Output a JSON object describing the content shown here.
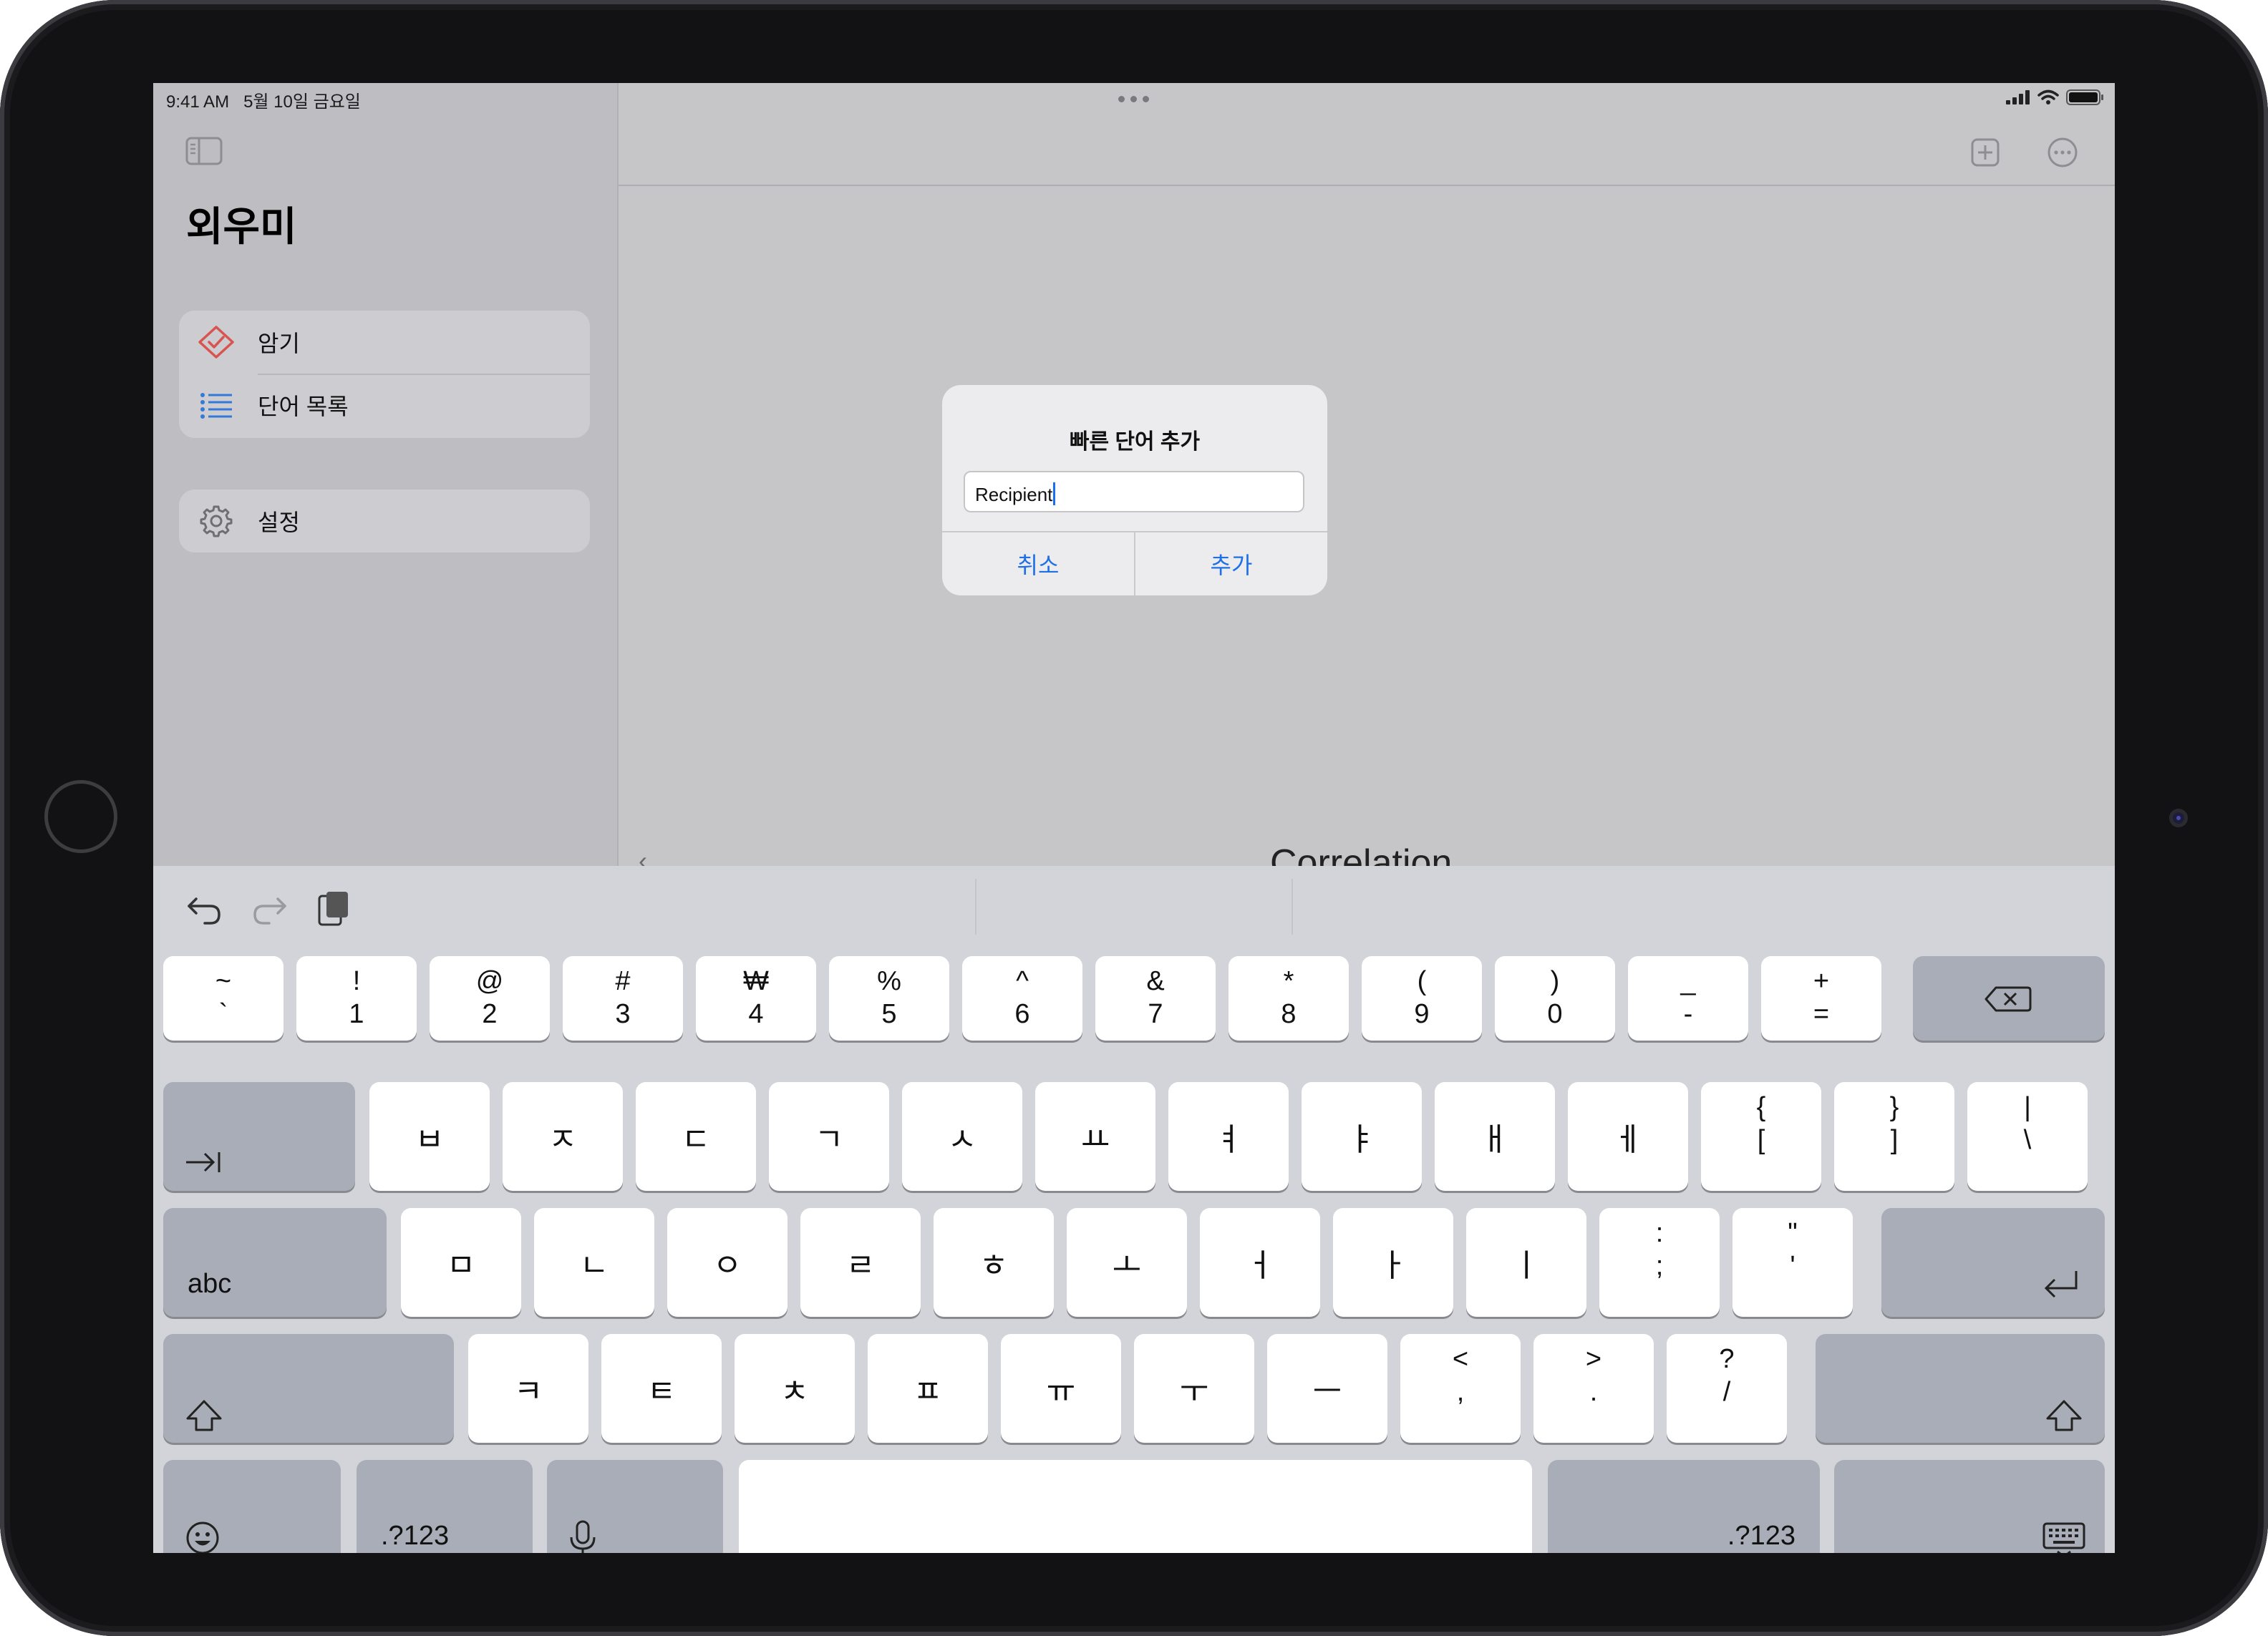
{
  "status": {
    "time": "9:41 AM",
    "date": "5월 10일 금요일"
  },
  "sidebar": {
    "app_title": "외우미",
    "items": [
      {
        "label": "암기",
        "icon": "diamond-check-icon"
      },
      {
        "label": "단어 목록",
        "icon": "list-bullet-icon"
      }
    ],
    "settings": {
      "label": "설정",
      "icon": "gear-icon"
    }
  },
  "main": {
    "word_preview": "Correlation"
  },
  "alert": {
    "title": "빠른 단어 추가",
    "input_value": "Recipient",
    "cancel_label": "취소",
    "add_label": "추가"
  },
  "keyboard": {
    "row1": [
      {
        "top": "~",
        "bottom": "`"
      },
      {
        "top": "!",
        "bottom": "1"
      },
      {
        "top": "@",
        "bottom": "2"
      },
      {
        "top": "#",
        "bottom": "3"
      },
      {
        "top": "₩",
        "bottom": "4"
      },
      {
        "top": "%",
        "bottom": "5"
      },
      {
        "top": "^",
        "bottom": "6"
      },
      {
        "top": "&",
        "bottom": "7"
      },
      {
        "top": "*",
        "bottom": "8"
      },
      {
        "top": "(",
        "bottom": "9"
      },
      {
        "top": ")",
        "bottom": "0"
      },
      {
        "top": "_",
        "bottom": "-"
      },
      {
        "top": "+",
        "bottom": "="
      }
    ],
    "row2": [
      "ㅂ",
      "ㅈ",
      "ㄷ",
      "ㄱ",
      "ㅅ",
      "ㅛ",
      "ㅕ",
      "ㅑ",
      "ㅐ",
      "ㅔ"
    ],
    "row2_extra": [
      {
        "top": "{",
        "bottom": "["
      },
      {
        "top": "}",
        "bottom": "]"
      },
      {
        "top": "|",
        "bottom": "\\"
      }
    ],
    "row3": [
      "ㅁ",
      "ㄴ",
      "ㅇ",
      "ㄹ",
      "ㅎ",
      "ㅗ",
      "ㅓ",
      "ㅏ",
      "ㅣ"
    ],
    "row3_extra": [
      {
        "top": ":",
        "bottom": ";"
      },
      {
        "top": "\"",
        "bottom": "'"
      }
    ],
    "row4": [
      "ㅋ",
      "ㅌ",
      "ㅊ",
      "ㅍ",
      "ㅠ",
      "ㅜ",
      "ㅡ"
    ],
    "row4_extra": [
      {
        "top": "<",
        "bottom": ","
      },
      {
        "top": ">",
        "bottom": "."
      },
      {
        "top": "?",
        "bottom": "/"
      }
    ],
    "abc_label": "abc",
    "numbers_label": ".?123"
  }
}
